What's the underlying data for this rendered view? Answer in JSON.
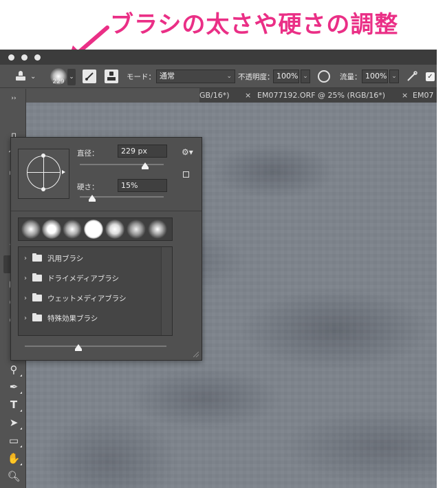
{
  "headline": "ブラシの太さや硬さの調整",
  "options_bar": {
    "brush_size": "229",
    "mode_label": "モード：",
    "mode_value": "通常",
    "opacity_label": "不透明度：",
    "opacity_value": "100%",
    "flow_label": "流量：",
    "flow_value": "100%"
  },
  "tabs": [
    {
      "label": "GB/16*)"
    },
    {
      "label": "EM077192.ORF @ 25% (RGB/16*)"
    },
    {
      "label": "EM07"
    }
  ],
  "tab_close": "×",
  "brush_popup": {
    "size_label": "直径：",
    "size_value": "229 px",
    "size_fraction": 0.78,
    "hardness_label": "硬さ：",
    "hardness_value": "15%",
    "hardness_fraction": 0.15,
    "folders": [
      {
        "label": "汎用ブラシ"
      },
      {
        "label": "ドライメディアブラシ"
      },
      {
        "label": "ウェットメディアブラシ"
      },
      {
        "label": "特殊効果ブラシ"
      }
    ],
    "preview_size_fraction": 0.38
  },
  "colors": {
    "accent": "#ea2f86",
    "panel": "#535353",
    "canvas": "#7e848c"
  },
  "toolbar_icons": [
    "pen-icon",
    "text-icon",
    "path-selection-icon",
    "rectangle-icon",
    "hand-icon",
    "zoom-icon",
    "more-icon"
  ]
}
